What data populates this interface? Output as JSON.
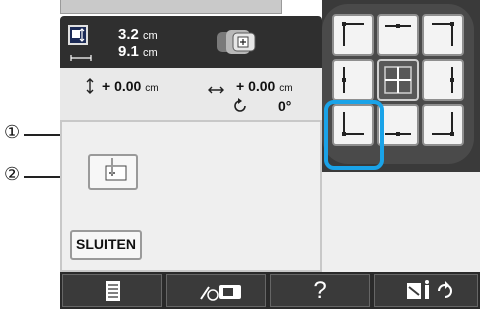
{
  "design_info": {
    "height": "3.2",
    "height_unit": "cm",
    "width": "9.1",
    "width_unit": "cm"
  },
  "offset": {
    "vertical_value": "+ 0.00",
    "vertical_unit": "cm",
    "horizontal_value": "+ 0.00",
    "horizontal_unit": "cm",
    "rotation": "0°"
  },
  "buttons": {
    "close_label": "SLUITEN"
  },
  "callouts": {
    "one": "①",
    "two": "②"
  },
  "bottom_bar": {
    "help_label": "?"
  },
  "position_grid": {
    "selected": "bottom-left"
  },
  "colors": {
    "highlight": "#1aa3e8",
    "panel_dark": "#3a3a3a"
  },
  "icons": [
    "size-icon",
    "hoop-icon",
    "vertical-arrow-icon",
    "horizontal-arrow-icon",
    "rotate-icon",
    "needle-start-icon",
    "memory-icon",
    "embroidery-edit-icon",
    "settings-icon"
  ]
}
